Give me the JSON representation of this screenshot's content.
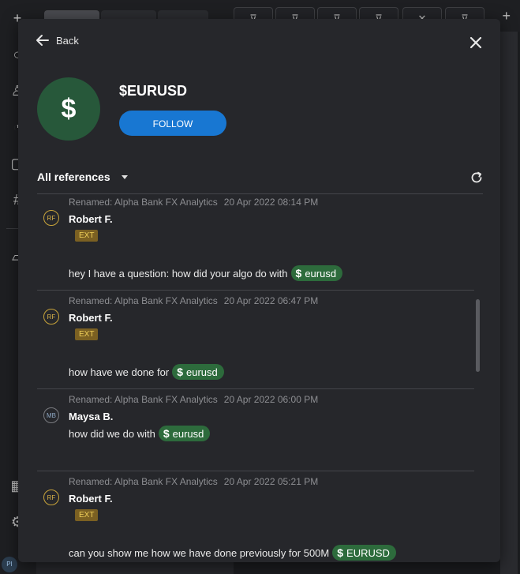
{
  "modal": {
    "back_label": "Back",
    "entity_symbol": "$",
    "title": "$EURUSD",
    "follow_label": "FOLLOW",
    "filter_label": "All references"
  },
  "references": [
    {
      "meta": "Renamed: Alpha Bank FX Analytics",
      "time": "20 Apr 2022 08:14 PM",
      "initials": "RF",
      "author": "Robert F.",
      "badge": "EXT",
      "text": "hey I have a question: how did your algo do with",
      "tag": "eurusd"
    },
    {
      "meta": "Renamed: Alpha Bank FX Analytics",
      "time": "20 Apr 2022 06:47 PM",
      "initials": "RF",
      "author": "Robert F.",
      "badge": "EXT",
      "text": "how have we done for",
      "tag": "eurusd"
    },
    {
      "meta": "Renamed: Alpha Bank FX Analytics",
      "time": "20 Apr 2022 06:00 PM",
      "initials": "MB",
      "author": "Maysa B.",
      "text": "how did we do with",
      "tag": "eurusd"
    },
    {
      "meta": "Renamed: Alpha Bank FX Analytics",
      "time": "20 Apr 2022 05:21 PM",
      "initials": "RF",
      "author": "Robert F.",
      "badge": "EXT",
      "text": "can you show me how we have done previously for 500M",
      "tag": "EURUSD"
    }
  ],
  "colors": {
    "accent": "#1877d2",
    "cashtag_bg": "#2d6b3c",
    "avatar_bg": "#27583a",
    "ext_bg": "#7b6022"
  },
  "icons": [
    "back-arrow-icon",
    "close-icon",
    "dollar-icon",
    "chevron-down-icon",
    "refresh-icon"
  ]
}
